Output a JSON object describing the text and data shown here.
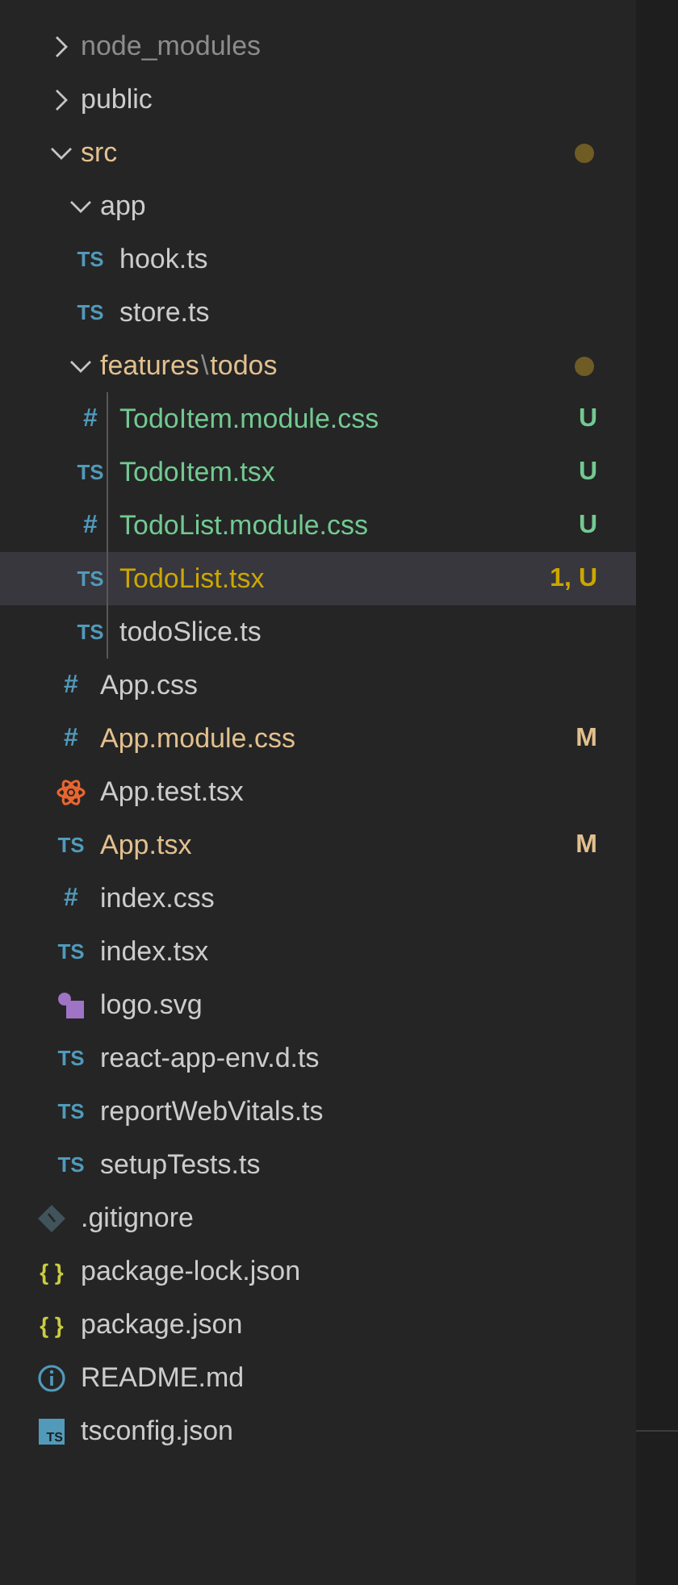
{
  "explorer": {
    "items": [
      {
        "name": "node_modules",
        "kind": "folder",
        "expanded": false,
        "selected": false,
        "color": "#8c8c8c"
      },
      {
        "name": "public",
        "kind": "folder",
        "expanded": false,
        "selected": false
      },
      {
        "name": "src",
        "kind": "folder",
        "expanded": true,
        "selected": false,
        "color": "#e2c08d",
        "dot": true,
        "children": [
          {
            "name": "app",
            "kind": "folder",
            "expanded": true,
            "selected": false,
            "children": [
              {
                "name": "hook.ts",
                "kind": "ts",
                "icon": "TS",
                "selected": false
              },
              {
                "name": "store.ts",
                "kind": "ts",
                "icon": "TS",
                "selected": false
              }
            ]
          },
          {
            "name": "features",
            "separator": "\\",
            "name_2": "todos",
            "kind": "folder",
            "expanded": true,
            "selected": false,
            "color": "#e2c08d",
            "dot": true,
            "children": [
              {
                "name": "TodoItem.module.css",
                "kind": "css",
                "icon": "#",
                "selected": false,
                "color": "#73c991",
                "badge": "U"
              },
              {
                "name": "TodoItem.tsx",
                "kind": "ts",
                "icon": "TS",
                "selected": false,
                "color": "#73c991",
                "badge": "U"
              },
              {
                "name": "TodoList.module.css",
                "kind": "css",
                "icon": "#",
                "selected": false,
                "color": "#73c991",
                "badge": "U"
              },
              {
                "name": "TodoList.tsx",
                "kind": "ts",
                "icon": "TS",
                "selected": true,
                "color": "#cca700",
                "badge": "1, U"
              },
              {
                "name": "todoSlice.ts",
                "kind": "ts",
                "icon": "TS",
                "selected": false
              }
            ]
          },
          {
            "name": "App.css",
            "kind": "css",
            "icon": "#",
            "selected": false
          },
          {
            "name": "App.module.css",
            "kind": "css",
            "icon": "#",
            "selected": false,
            "color": "#e2c08d",
            "badge": "M"
          },
          {
            "name": "App.test.tsx",
            "kind": "react",
            "selected": false
          },
          {
            "name": "App.tsx",
            "kind": "ts",
            "icon": "TS",
            "selected": false,
            "color": "#e2c08d",
            "badge": "M"
          },
          {
            "name": "index.css",
            "kind": "css",
            "icon": "#",
            "selected": false
          },
          {
            "name": "index.tsx",
            "kind": "ts",
            "icon": "TS",
            "selected": false
          },
          {
            "name": "logo.svg",
            "kind": "svg",
            "selected": false
          },
          {
            "name": "react-app-env.d.ts",
            "kind": "ts",
            "icon": "TS",
            "selected": false
          },
          {
            "name": "reportWebVitals.ts",
            "kind": "ts",
            "icon": "TS",
            "selected": false
          },
          {
            "name": "setupTests.ts",
            "kind": "ts",
            "icon": "TS",
            "selected": false
          }
        ]
      },
      {
        "name": ".gitignore",
        "kind": "git",
        "selected": false
      },
      {
        "name": "package-lock.json",
        "kind": "json",
        "icon": "{ }",
        "selected": false
      },
      {
        "name": "package.json",
        "kind": "json",
        "icon": "{ }",
        "selected": false
      },
      {
        "name": "README.md",
        "kind": "info",
        "selected": false
      },
      {
        "name": "tsconfig.json",
        "kind": "tsconfig",
        "icon": "TS",
        "selected": false
      }
    ]
  }
}
